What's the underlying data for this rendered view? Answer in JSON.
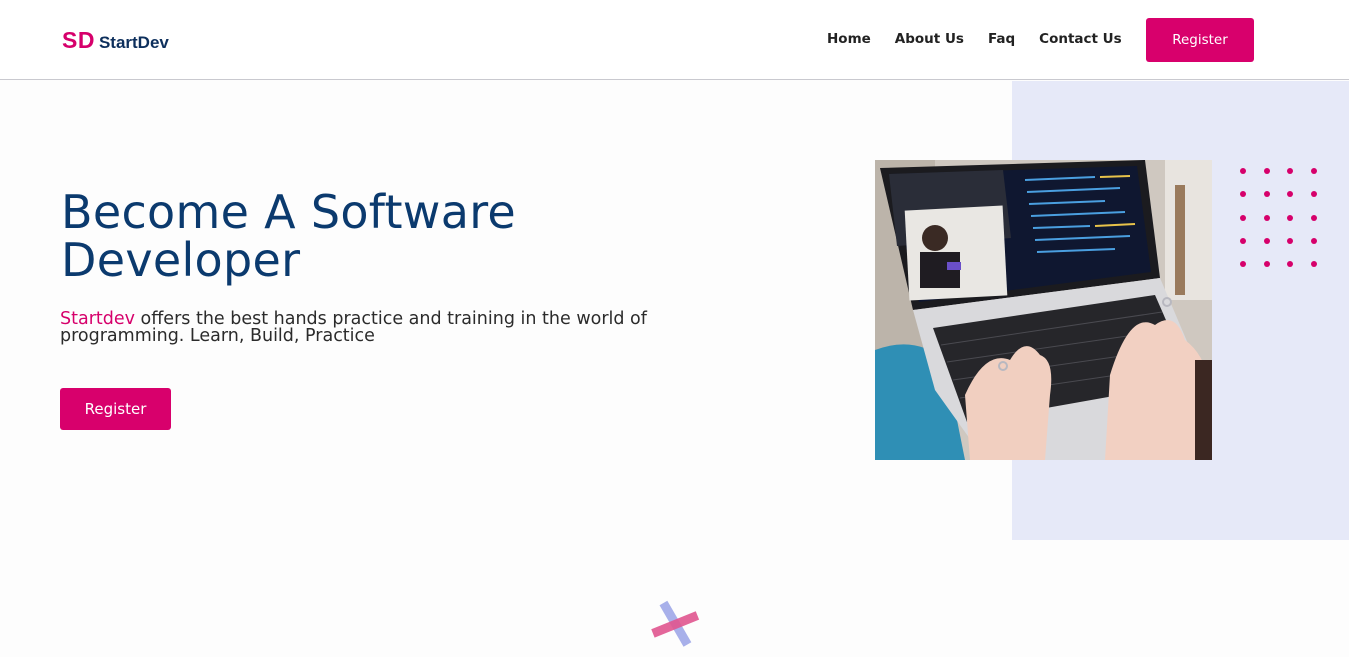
{
  "nav": {
    "logo_mark": "SD",
    "logo_text": "StartDev",
    "links": [
      "Home",
      "About Us",
      "Faq",
      "Contact Us"
    ],
    "register_label": "Register"
  },
  "hero": {
    "title": "Become A Software Developer",
    "brand": "Startdev",
    "description": " offers the best hands practice and training in the world of programming. Learn, Build, Practice",
    "cta_label": "Register"
  },
  "colors": {
    "brand_pink": "#d8006c",
    "navy": "#0b3a6e",
    "panel_lavender": "#e6e9f8"
  }
}
